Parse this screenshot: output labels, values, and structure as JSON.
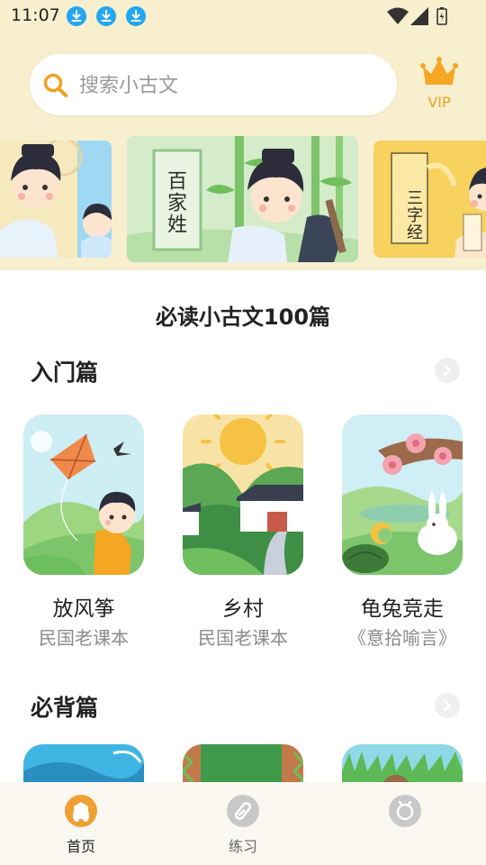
{
  "status_bar": {
    "time": "11:07"
  },
  "search": {
    "placeholder": "搜索小古文"
  },
  "vip": {
    "label": "VIP"
  },
  "banners": [
    {
      "title": ""
    },
    {
      "title": "百家姓"
    },
    {
      "title": "三字经"
    }
  ],
  "section_title": "必读小古文100篇",
  "categories": [
    {
      "title": "入门篇",
      "items": [
        {
          "title": "放风筝",
          "subtitle": "民国老课本"
        },
        {
          "title": "乡村",
          "subtitle": "民国老课本"
        },
        {
          "title": "龟兔竞走",
          "subtitle": "《意拾喻言》"
        }
      ]
    },
    {
      "title": "必背篇"
    }
  ],
  "bottom_nav": [
    {
      "label": "首页",
      "active": true
    },
    {
      "label": "练习",
      "active": false
    },
    {
      "label": "",
      "active": false
    }
  ],
  "colors": {
    "accent": "#f0a020",
    "header_bg": "#f8efcf",
    "active_icon": "#f0a033",
    "inactive_icon": "#c8c8c8",
    "download_badge": "#22a7f0"
  }
}
